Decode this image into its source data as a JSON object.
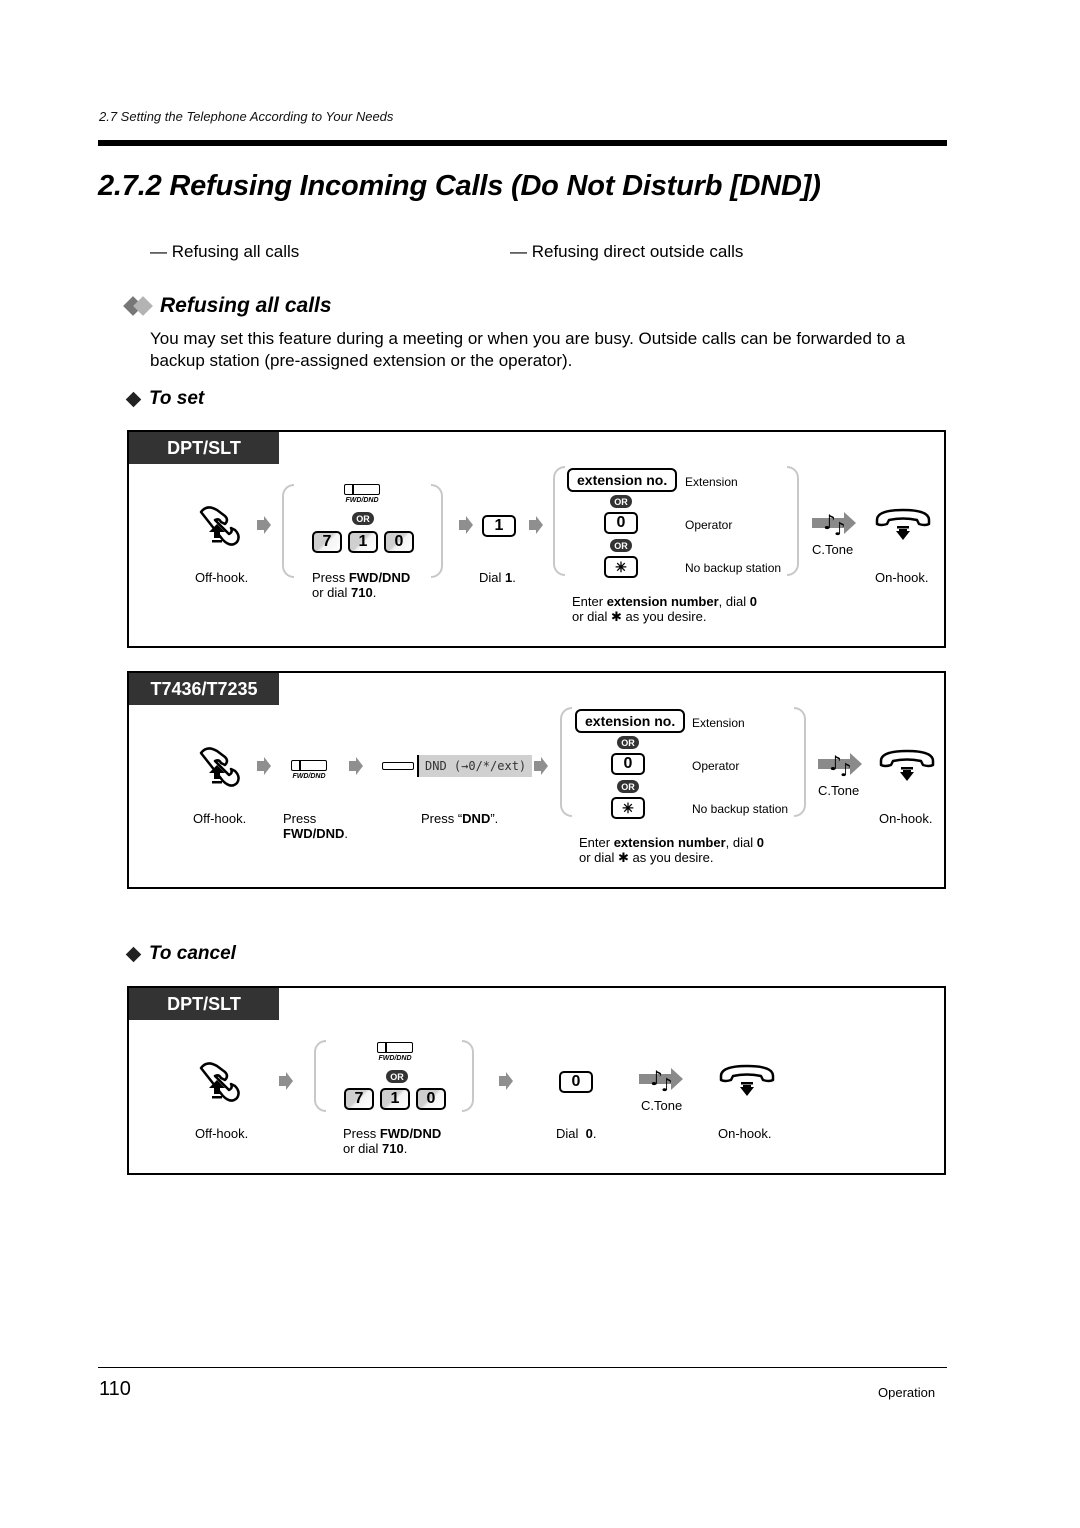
{
  "running_head": "2.7   Setting the Telephone According to Your Needs",
  "page_title": "2.7.2   Refusing Incoming Calls (Do Not Disturb [DND])",
  "toc_links": [
    "— Refusing all calls",
    "— Refusing direct outside calls"
  ],
  "section": {
    "title": "Refusing all calls",
    "body": "You may set this feature during a meeting or when you are busy. Outside calls can be forwarded to a backup station (pre-assigned extension or the operator)."
  },
  "to_set": {
    "heading": "To set",
    "panels": [
      {
        "tab": "DPT/SLT",
        "steps": {
          "offhook": "Off-hook.",
          "press_fwd": [
            "Press ",
            "FWD/DND",
            "or dial ",
            "710",
            "."
          ],
          "fwd_caption": "FWD/DND",
          "or": "OR",
          "keys_710": [
            "7",
            "1",
            "0"
          ],
          "dial1_key": "1",
          "dial1": [
            "Dial ",
            "1",
            "."
          ],
          "options": [
            {
              "key": "extension no.",
              "label": "Extension"
            },
            {
              "key": "0",
              "label": "Operator"
            },
            {
              "key": "✳",
              "label": "No backup station"
            }
          ],
          "enter_note": [
            "Enter ",
            "extension number",
            ", dial ",
            "0",
            "or dial ✱ as you desire."
          ],
          "ctone": "C.Tone",
          "onhook": "On-hook."
        }
      },
      {
        "tab": "T7436/T7235",
        "steps": {
          "offhook": "Off-hook.",
          "press": "Press",
          "press_bold": "FWD/DND",
          "fwd_caption": "FWD/DND",
          "lcd_text": "DND  (→0/*/ext)",
          "press_dnd": [
            "Press “",
            "DND",
            "”."
          ],
          "or": "OR",
          "options": [
            {
              "key": "extension no.",
              "label": "Extension"
            },
            {
              "key": "0",
              "label": "Operator"
            },
            {
              "key": "✳",
              "label": "No backup station"
            }
          ],
          "enter_note": [
            "Enter ",
            "extension number",
            ", dial ",
            "0",
            "or dial ✱ as you desire."
          ],
          "ctone": "C.Tone",
          "onhook": "On-hook."
        }
      }
    ]
  },
  "to_cancel": {
    "heading": "To cancel",
    "panel": {
      "tab": "DPT/SLT",
      "steps": {
        "offhook": "Off-hook.",
        "press_fwd": [
          "Press ",
          "FWD/DND",
          "or dial ",
          "710",
          "."
        ],
        "fwd_caption": "FWD/DND",
        "or": "OR",
        "keys_710": [
          "7",
          "1",
          "0"
        ],
        "dial0_key": "0",
        "dial0": [
          "Dial  ",
          "0",
          "."
        ],
        "ctone": "C.Tone",
        "onhook": "On-hook."
      }
    }
  },
  "footer": {
    "page_number": "110",
    "section": "Operation"
  }
}
